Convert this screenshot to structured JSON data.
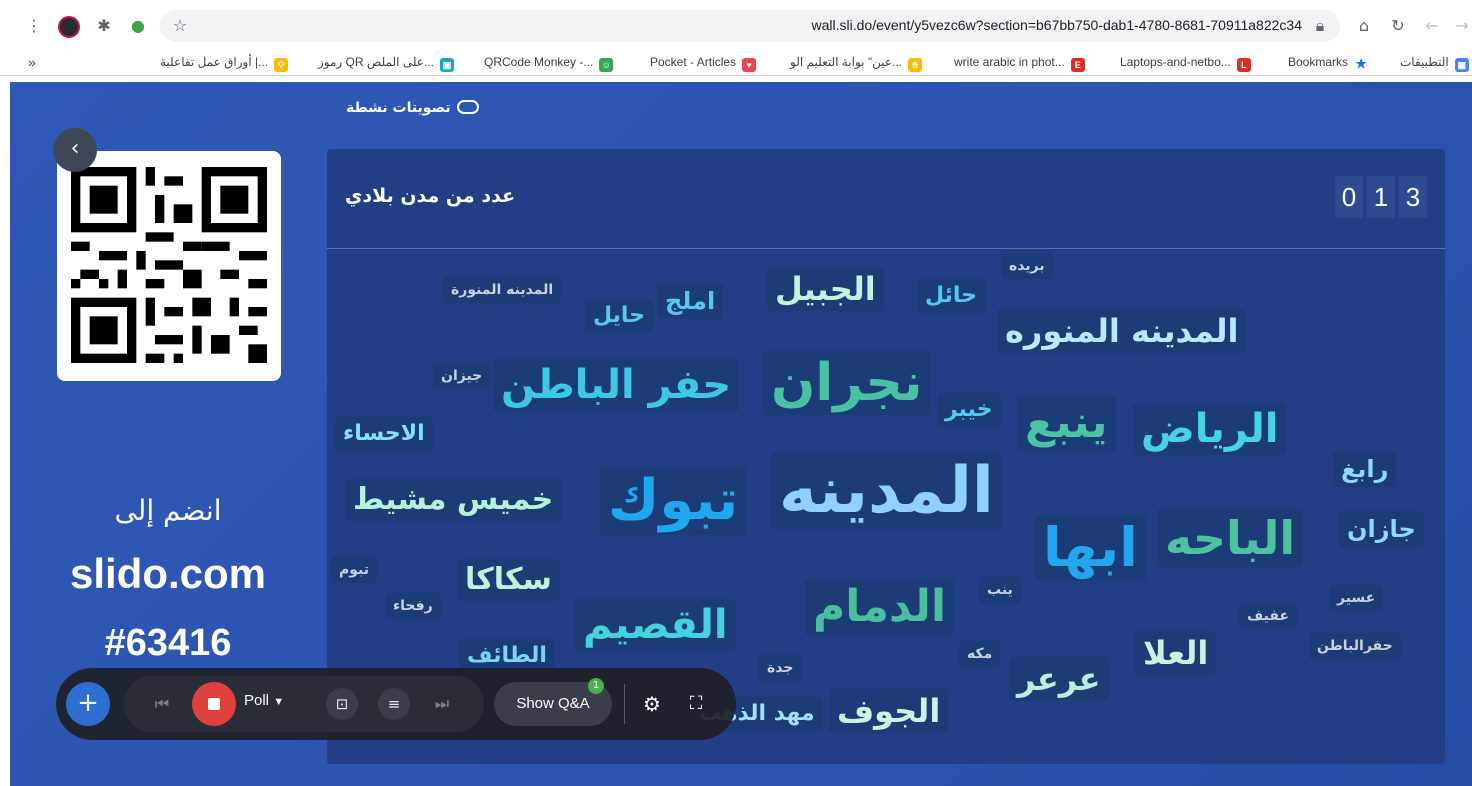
{
  "browser": {
    "url": "wall.sli.do/event/y5vezc6w?section=b67bb750-dab1-4780-8681-70911a822c34",
    "bookmarks": [
      {
        "label": "التطبيقات",
        "color": "#4285f4",
        "icon": "apps-grid-icon"
      },
      {
        "label": "Bookmarks",
        "color": "#1a73e8",
        "icon": "star-icon"
      },
      {
        "label": "Laptops-and-netbo...",
        "color": "#d93025",
        "icon": "l-favicon"
      },
      {
        "label": "write arabic in phot...",
        "color": "#d93025",
        "icon": "e-favicon"
      },
      {
        "label": "عين\" بوابة التعليم الو...",
        "color": "#fbbc04",
        "icon": "hand-favicon"
      },
      {
        "label": "Pocket - Articles",
        "color": "#ef4056",
        "icon": "pocket-icon"
      },
      {
        "label": "QRCode Monkey -...",
        "color": "#34a853",
        "icon": "monkey-favicon"
      },
      {
        "label": "رموز QR على الملص...",
        "color": "#12a5d6",
        "icon": "qr-favicon"
      },
      {
        "label": "أوراق عمل تفاعلية |...",
        "color": "#fbbc04",
        "icon": "bulb-favicon"
      }
    ],
    "more_bookmarks": "»"
  },
  "slido": {
    "active_polls_label": "تصويتات نشطة",
    "join_label": "انضم إلى",
    "site": "slido.com",
    "event_code": "#63416",
    "poll": {
      "title": "عدد من مدن بلادي",
      "counter_digits": [
        "0",
        "1",
        "3"
      ]
    },
    "words": [
      {
        "text": "المدينه",
        "color": "#8fd0ff"
      },
      {
        "text": "تبوك",
        "color": "#1fa8f0"
      },
      {
        "text": "نجران",
        "color": "#49c2a4"
      },
      {
        "text": "ابها",
        "color": "#22a7ee"
      },
      {
        "text": "ينبع",
        "color": "#4dc3a5"
      },
      {
        "text": "الرياض",
        "color": "#46d3e3"
      },
      {
        "text": "الباحه",
        "color": "#4ec2a0"
      },
      {
        "text": "حفر الباطن",
        "color": "#3dc8e6"
      },
      {
        "text": "الدمام",
        "color": "#49bfa0"
      },
      {
        "text": "القصيم",
        "color": "#46d2dc"
      },
      {
        "text": "المدينه المنوره",
        "color": "#b9e9ff"
      },
      {
        "text": "خميس مشيط",
        "color": "#b6f2d8"
      },
      {
        "text": "الجبيل",
        "color": "#c3f3de"
      },
      {
        "text": "سكاكا",
        "color": "#c0f2dc"
      },
      {
        "text": "الجوف",
        "color": "#c8f5e2"
      },
      {
        "text": "عرعر",
        "color": "#b9f0da"
      },
      {
        "text": "العلا",
        "color": "#c6f4df"
      },
      {
        "text": "مهد الذهب",
        "color": "#9fdfff"
      },
      {
        "text": "الطائف",
        "color": "#7ad6f5"
      },
      {
        "text": "الاحساء",
        "color": "#88e0ff"
      },
      {
        "text": "املج",
        "color": "#57c8ef"
      },
      {
        "text": "حايل",
        "color": "#57c8ef"
      },
      {
        "text": "حائل",
        "color": "#57c8ef"
      },
      {
        "text": "خيبر",
        "color": "#57c8ef"
      },
      {
        "text": "رابغ",
        "color": "#8fd8ff"
      },
      {
        "text": "جازان",
        "color": "#8fd8ff"
      },
      {
        "text": "بريده",
        "color": "#c9d2e0"
      },
      {
        "text": "المدينه المنورة",
        "color": "#c9d2e0"
      },
      {
        "text": "جيزان",
        "color": "#c9d2e0"
      },
      {
        "text": "تبوم",
        "color": "#c9d2e0"
      },
      {
        "text": "رفحاء",
        "color": "#c9d2e0"
      },
      {
        "text": "ينب",
        "color": "#c9d2e0"
      },
      {
        "text": "مكه",
        "color": "#c9d2e0"
      },
      {
        "text": "جدة",
        "color": "#c9d2e0"
      },
      {
        "text": "عسير",
        "color": "#c9d2e0"
      },
      {
        "text": "عفيف",
        "color": "#c9d2e0"
      },
      {
        "text": "حفرالباطن",
        "color": "#c9d2e0"
      }
    ],
    "toolbar": {
      "poll_label": "Poll",
      "show_qa_label": "Show Q&A",
      "qa_badge": "1"
    }
  }
}
